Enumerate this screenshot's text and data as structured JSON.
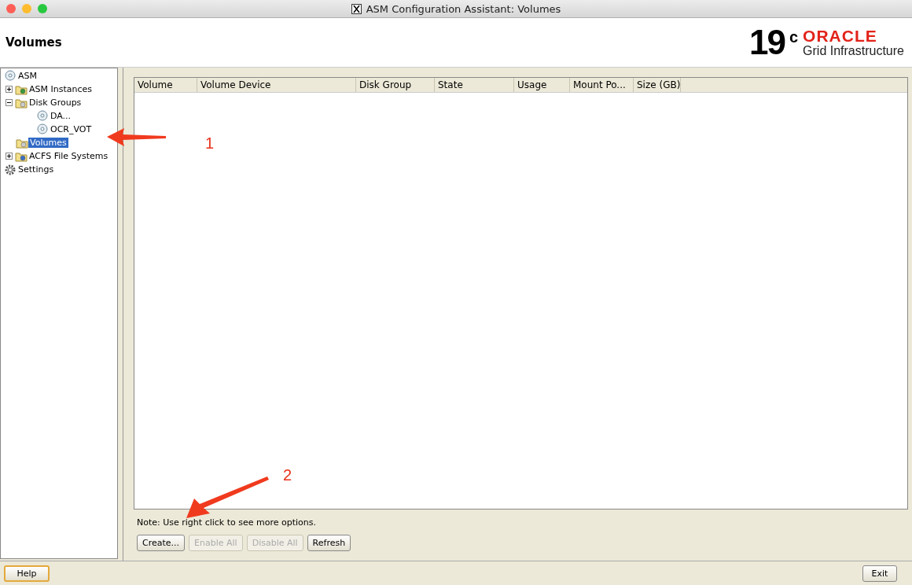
{
  "window": {
    "title": "ASM Configuration Assistant: Volumes"
  },
  "header": {
    "title": "Volumes",
    "logo": {
      "version": "19",
      "suffix": "c",
      "brand": "ORACLE",
      "product": "Grid Infrastructure"
    }
  },
  "tree": [
    {
      "label": "ASM",
      "kind": "root",
      "selected": false
    },
    {
      "label": "ASM Instances",
      "kind": "branch",
      "expanded": false,
      "selected": false
    },
    {
      "label": "Disk Groups",
      "kind": "branch",
      "expanded": true,
      "selected": false,
      "children": [
        {
          "label": "DA...",
          "kind": "leaf",
          "selected": false
        },
        {
          "label": "OCR_VOT",
          "kind": "leaf",
          "selected": false
        }
      ]
    },
    {
      "label": "Volumes",
      "kind": "leaf",
      "selected": true
    },
    {
      "label": "ACFS File Systems",
      "kind": "branch",
      "expanded": false,
      "selected": false
    },
    {
      "label": "Settings",
      "kind": "top",
      "selected": false
    }
  ],
  "table": {
    "columns": [
      "Volume",
      "Volume Device",
      "Disk Group",
      "State",
      "Usage",
      "Mount Po...",
      "Size (GB)"
    ]
  },
  "note": "Note: Use right click to see more options.",
  "buttons": [
    {
      "label": "Create...",
      "disabled": false
    },
    {
      "label": "Enable All",
      "disabled": true
    },
    {
      "label": "Disable All",
      "disabled": true
    },
    {
      "label": "Refresh",
      "disabled": false
    }
  ],
  "footer": {
    "help": "Help",
    "exit": "Exit"
  },
  "annotations": [
    "1",
    "2"
  ]
}
